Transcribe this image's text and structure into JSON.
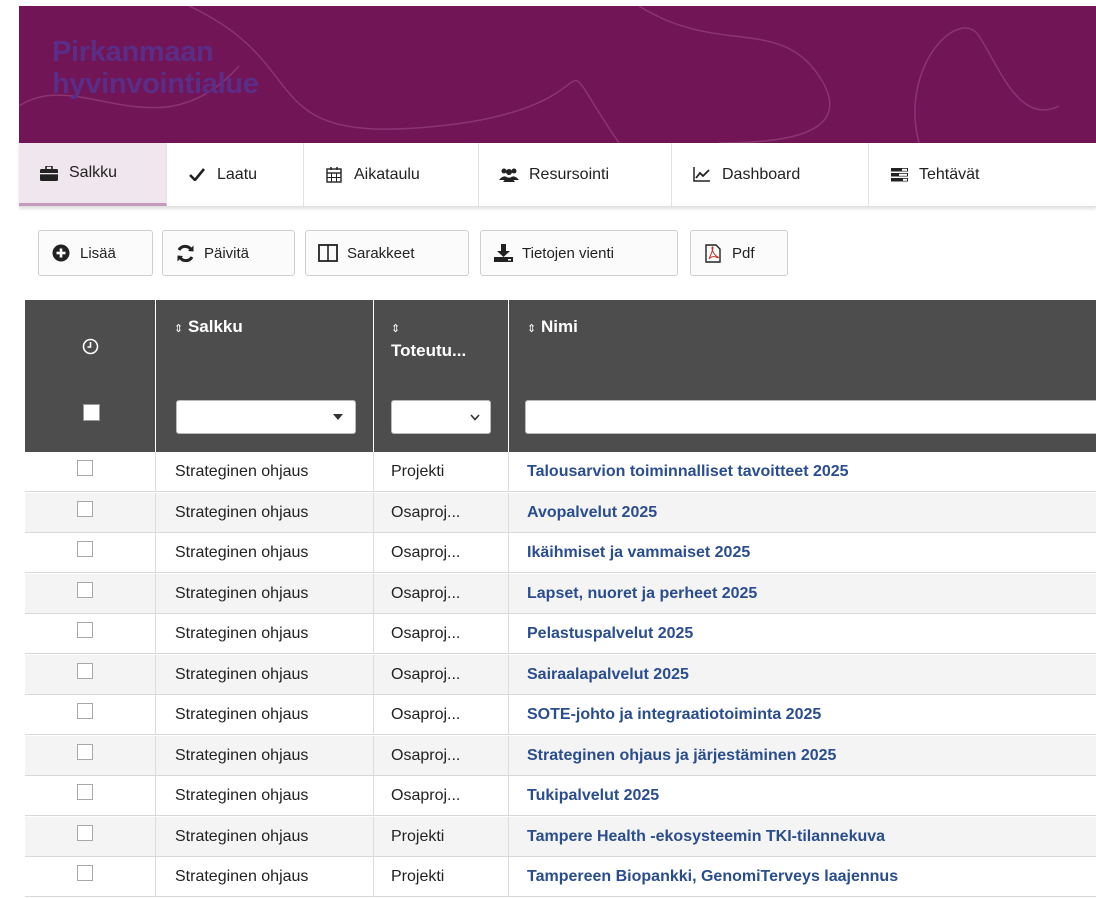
{
  "header": {
    "org_line1": "Pirkanmaan",
    "org_line2": "hyvinvointialue"
  },
  "tabs": [
    {
      "label": "Salkku",
      "icon": "briefcase-icon",
      "active": true
    },
    {
      "label": "Laatu",
      "icon": "check-icon",
      "active": false
    },
    {
      "label": "Aikataulu",
      "icon": "calendar-icon",
      "active": false
    },
    {
      "label": "Resursointi",
      "icon": "users-icon",
      "active": false
    },
    {
      "label": "Dashboard",
      "icon": "line-chart-icon",
      "active": false
    },
    {
      "label": "Tehtävät",
      "icon": "tasks-icon",
      "active": false
    }
  ],
  "toolbar": {
    "add_label": "Lisää",
    "refresh_label": "Päivitä",
    "columns_label": "Sarakkeet",
    "export_label": "Tietojen vienti",
    "pdf_label": "Pdf"
  },
  "table": {
    "sort_glyph": "⇕",
    "columns": {
      "salkku": "Salkku",
      "toteutus": "Toteutu...",
      "nimi": "Nimi"
    },
    "rows": [
      {
        "salkku": "Strateginen ohjaus",
        "toteutus": "Projekti",
        "nimi": "Talousarvion toiminnalliset tavoitteet 2025"
      },
      {
        "salkku": "Strateginen ohjaus",
        "toteutus": "Osaproj...",
        "nimi": "Avopalvelut 2025"
      },
      {
        "salkku": "Strateginen ohjaus",
        "toteutus": "Osaproj...",
        "nimi": "Ikäihmiset ja vammaiset 2025"
      },
      {
        "salkku": "Strateginen ohjaus",
        "toteutus": "Osaproj...",
        "nimi": "Lapset, nuoret ja perheet 2025"
      },
      {
        "salkku": "Strateginen ohjaus",
        "toteutus": "Osaproj...",
        "nimi": "Pelastuspalvelut 2025"
      },
      {
        "salkku": "Strateginen ohjaus",
        "toteutus": "Osaproj...",
        "nimi": "Sairaalapalvelut 2025"
      },
      {
        "salkku": "Strateginen ohjaus",
        "toteutus": "Osaproj...",
        "nimi": "SOTE-johto ja integraatiotoiminta 2025"
      },
      {
        "salkku": "Strateginen ohjaus",
        "toteutus": "Osaproj...",
        "nimi": "Strateginen ohjaus ja järjestäminen 2025"
      },
      {
        "salkku": "Strateginen ohjaus",
        "toteutus": "Osaproj...",
        "nimi": "Tukipalvelut 2025"
      },
      {
        "salkku": "Strateginen ohjaus",
        "toteutus": "Projekti",
        "nimi": "Tampere Health -ekosysteemin TKI-tilannekuva"
      },
      {
        "salkku": "Strateginen ohjaus",
        "toteutus": "Projekti",
        "nimi": "Tampereen Biopankki, GenomiTerveys laajennus"
      }
    ]
  },
  "colors": {
    "banner": "#721556",
    "logo": "#5a2d86",
    "header_bg": "#4d4d4d",
    "link": "#2a4d8f",
    "active_tab": "#f0e6ee"
  }
}
